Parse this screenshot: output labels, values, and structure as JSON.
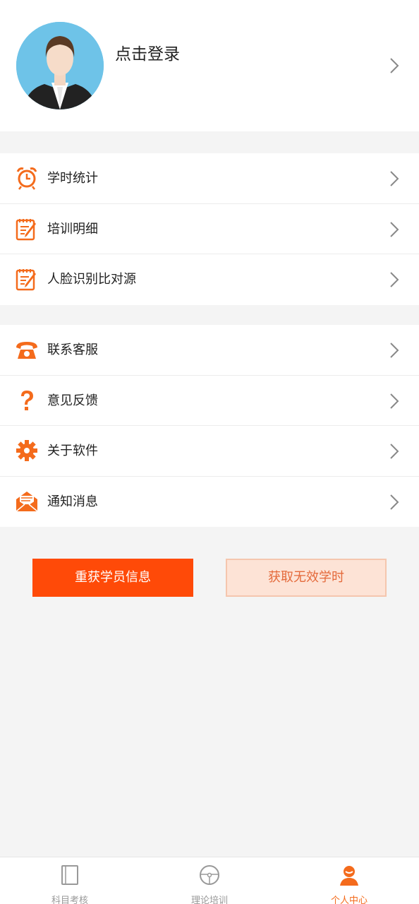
{
  "profile": {
    "login_label": "点击登录"
  },
  "menu_group_1": [
    {
      "label": "学时统计",
      "icon": "alarm-clock-icon"
    },
    {
      "label": "培训明细",
      "icon": "notepad-pencil-icon"
    },
    {
      "label": "人脸识别比对源",
      "icon": "notepad-pencil-icon"
    }
  ],
  "menu_group_2": [
    {
      "label": "联系客服",
      "icon": "telephone-icon"
    },
    {
      "label": "意见反馈",
      "icon": "question-mark-icon"
    },
    {
      "label": "关于软件",
      "icon": "gear-icon"
    },
    {
      "label": "通知消息",
      "icon": "envelope-icon"
    }
  ],
  "buttons": {
    "refetch_label": "重获学员信息",
    "invalid_hours_label": "获取无效学时"
  },
  "tabbar": {
    "items": [
      {
        "label": "科目考核",
        "icon": "book-icon",
        "active": false
      },
      {
        "label": "理论培训",
        "icon": "steering-wheel-icon",
        "active": false
      },
      {
        "label": "个人中心",
        "icon": "person-icon",
        "active": true
      }
    ]
  },
  "colors": {
    "accent": "#ff4a08",
    "icon_orange": "#f46b1c",
    "secondary_bg": "#fde3d6",
    "avatar_bg": "#6ec3e8"
  }
}
